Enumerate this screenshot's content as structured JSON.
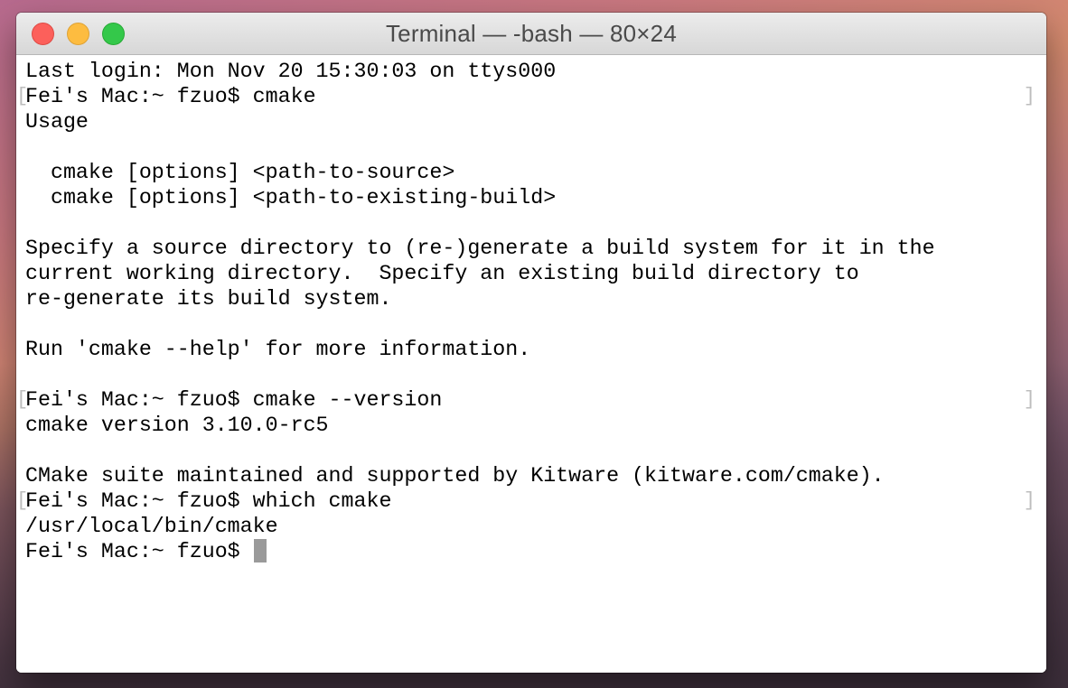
{
  "window": {
    "title": "Terminal — -bash — 80×24"
  },
  "terminal": {
    "lines": [
      {
        "text": "Last login: Mon Nov 20 15:30:03 on ttys000",
        "marked": false
      },
      {
        "text": "Fei's Mac:~ fzuo$ cmake",
        "marked": true
      },
      {
        "text": "Usage",
        "marked": false
      },
      {
        "text": "",
        "marked": false
      },
      {
        "text": "  cmake [options] <path-to-source>",
        "marked": false
      },
      {
        "text": "  cmake [options] <path-to-existing-build>",
        "marked": false
      },
      {
        "text": "",
        "marked": false
      },
      {
        "text": "Specify a source directory to (re-)generate a build system for it in the",
        "marked": false
      },
      {
        "text": "current working directory.  Specify an existing build directory to",
        "marked": false
      },
      {
        "text": "re-generate its build system.",
        "marked": false
      },
      {
        "text": "",
        "marked": false
      },
      {
        "text": "Run 'cmake --help' for more information.",
        "marked": false
      },
      {
        "text": "",
        "marked": false
      },
      {
        "text": "Fei's Mac:~ fzuo$ cmake --version",
        "marked": true
      },
      {
        "text": "cmake version 3.10.0-rc5",
        "marked": false
      },
      {
        "text": "",
        "marked": false
      },
      {
        "text": "CMake suite maintained and supported by Kitware (kitware.com/cmake).",
        "marked": false
      },
      {
        "text": "Fei's Mac:~ fzuo$ which cmake",
        "marked": true
      },
      {
        "text": "/usr/local/bin/cmake",
        "marked": false
      }
    ],
    "prompt": "Fei's Mac:~ fzuo$ ",
    "mark_left": "[",
    "mark_right": "]"
  },
  "colors": {
    "close": "#fc605b",
    "minimize": "#fdbc40",
    "zoom": "#34c84a",
    "cursor": "#9a9a9a"
  }
}
